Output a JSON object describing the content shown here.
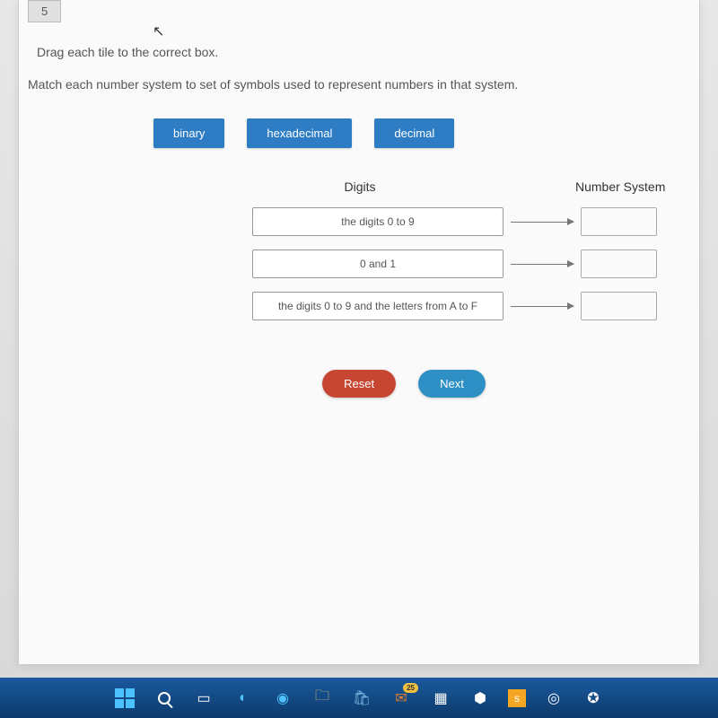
{
  "question_number": "5",
  "instruction_1": "Drag each tile to the correct box.",
  "instruction_2": "Match each number system to set of symbols used to represent numbers in that system.",
  "tiles": [
    "binary",
    "hexadecimal",
    "decimal"
  ],
  "columns": {
    "left": "Digits",
    "right": "Number System"
  },
  "rows": [
    {
      "digits": "the digits 0 to 9"
    },
    {
      "digits": "0 and 1"
    },
    {
      "digits": "the digits 0 to 9 and the letters from A to F"
    }
  ],
  "buttons": {
    "reset": "Reset",
    "next": "Next"
  },
  "taskbar_badge": "25"
}
